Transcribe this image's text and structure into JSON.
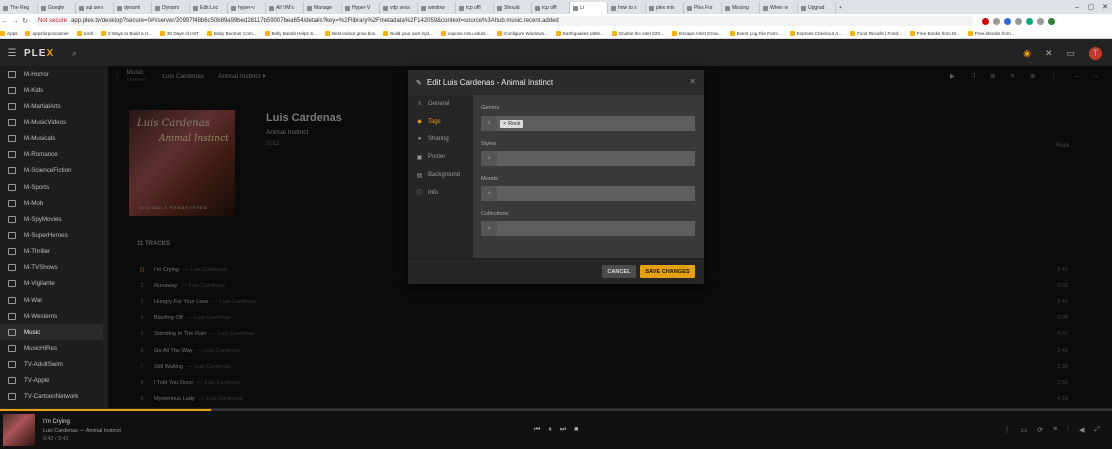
{
  "browser": {
    "tabs": [
      "The Reg",
      "Google",
      "sql serv",
      "dynami",
      "Dynami",
      "Edit Loc",
      "hyper-v",
      "All VM's",
      "Manage",
      "Hyper-V",
      "vdp sess",
      "window",
      "tcp offl",
      "Should",
      "tcp offl",
      "Li",
      "how to s",
      "plex mix",
      "Plex For",
      "Missing",
      "When w",
      "Upgrad"
    ],
    "not_secure": "Not secure",
    "url": "app.plex.tv/desktop?secure=0#!/server/20997f48b6c50b89a99bed28117b59007bea654/details?key=%2Flibrary%2Fmetadata%2F142059&context=source%3Ahub.music.recent.added",
    "bookmarks": [
      "Apps",
      "appsforpcscanner",
      "tordl",
      "3 Ways to Build a H...",
      "30 Days of HIIT",
      "Baby Boomer Com...",
      "Belly Bandit Helps S...",
      "Best indoor grow box",
      "Build your own hyd...",
      "capone.msu.edu/s...",
      "Configure Windows...",
      "Earthquakes rattle...",
      "Enable the Intel 82S...",
      "Escape Artist Drow...",
      "Event Log File Form...",
      "Express Checkout A...",
      "Food Recalls | Food...",
      "Free Books from M...",
      "Free ebooks from..."
    ]
  },
  "header": {
    "logo_a": "PLE",
    "logo_b": "X",
    "avatar": "T"
  },
  "sidebar": {
    "items": [
      "M-Horror",
      "M-Kids",
      "M-MartialArts",
      "M-MusicVideos",
      "M-Musicals",
      "M-Romance",
      "M-ScienceFiction",
      "M-Sports",
      "M-Mob",
      "M-SpyMovies",
      "M-SuperHeroes",
      "M-Thriller",
      "M-TVShows",
      "M-Vigilante",
      "M-War",
      "M-Westerns",
      "Music",
      "MusicHiRes",
      "TV-AdultSwim",
      "TV-Apple",
      "TV-CartoonNetwork"
    ]
  },
  "subheader": {
    "library": "Music",
    "library_sub": "4 EXPORT",
    "artist": "Luis Cardenas",
    "album": "Animal Instinct"
  },
  "album": {
    "art_line1": "Luis Cardenas",
    "art_line2": "Animal Instinct",
    "art_line3": "DIGITALLY REMASTERED",
    "artist": "Luis Cardenas",
    "title": "Animal Instinct",
    "year": "2012",
    "genre": "Rock",
    "track_count": "11 TRACKS"
  },
  "tracks": [
    {
      "n": "",
      "title": "I'm Crying",
      "artist": "Luis Cardenas",
      "dur": "3:41"
    },
    {
      "n": "2",
      "title": "Runaway",
      "artist": "Luis Cardenas",
      "dur": "3:02"
    },
    {
      "n": "3",
      "title": "Hungry For Your Love",
      "artist": "Luis Cardenas",
      "dur": "3:46"
    },
    {
      "n": "4",
      "title": "Blasting Off",
      "artist": "Luis Cardenas",
      "dur": "3:09"
    },
    {
      "n": "5",
      "title": "Standing In The Rain",
      "artist": "Luis Cardenas",
      "dur": "4:07"
    },
    {
      "n": "6",
      "title": "Go All The Way",
      "artist": "Luis Cardenas",
      "dur": "3:42"
    },
    {
      "n": "7",
      "title": "Still Waiting",
      "artist": "Luis Cardenas",
      "dur": "3:39"
    },
    {
      "n": "8",
      "title": "I Told You Once",
      "artist": "Luis Cardenas",
      "dur": "2:52"
    },
    {
      "n": "9",
      "title": "Mysterious Lady",
      "artist": "Luis Cardenas",
      "dur": "4:19"
    }
  ],
  "modal": {
    "title": "Edit Luis Cardenas - Animal Instinct",
    "nav": [
      {
        "label": "General",
        "icon": "general-icon",
        "glyph": "≡"
      },
      {
        "label": "Tags",
        "icon": "tag-icon",
        "glyph": "◆"
      },
      {
        "label": "Sharing",
        "icon": "sharing-icon",
        "glyph": "●"
      },
      {
        "label": "Poster",
        "icon": "poster-icon",
        "glyph": "▣"
      },
      {
        "label": "Background",
        "icon": "background-icon",
        "glyph": "▤"
      },
      {
        "label": "Info",
        "icon": "info-icon",
        "glyph": "ⓘ"
      }
    ],
    "active_nav": "Tags",
    "fields": {
      "genres_label": "Genres",
      "genre_chip": "Rock",
      "styles_label": "Styles",
      "moods_label": "Moods",
      "collections_label": "Collections"
    },
    "cancel": "CANCEL",
    "save": "SAVE CHANGES"
  },
  "player": {
    "title": "I'm Crying",
    "subtitle": "Luis Cardenas — Animal Instinct",
    "time": "0:42 / 3:41",
    "progress": 0.19
  },
  "colors": {
    "accent": "#e5a00d"
  }
}
